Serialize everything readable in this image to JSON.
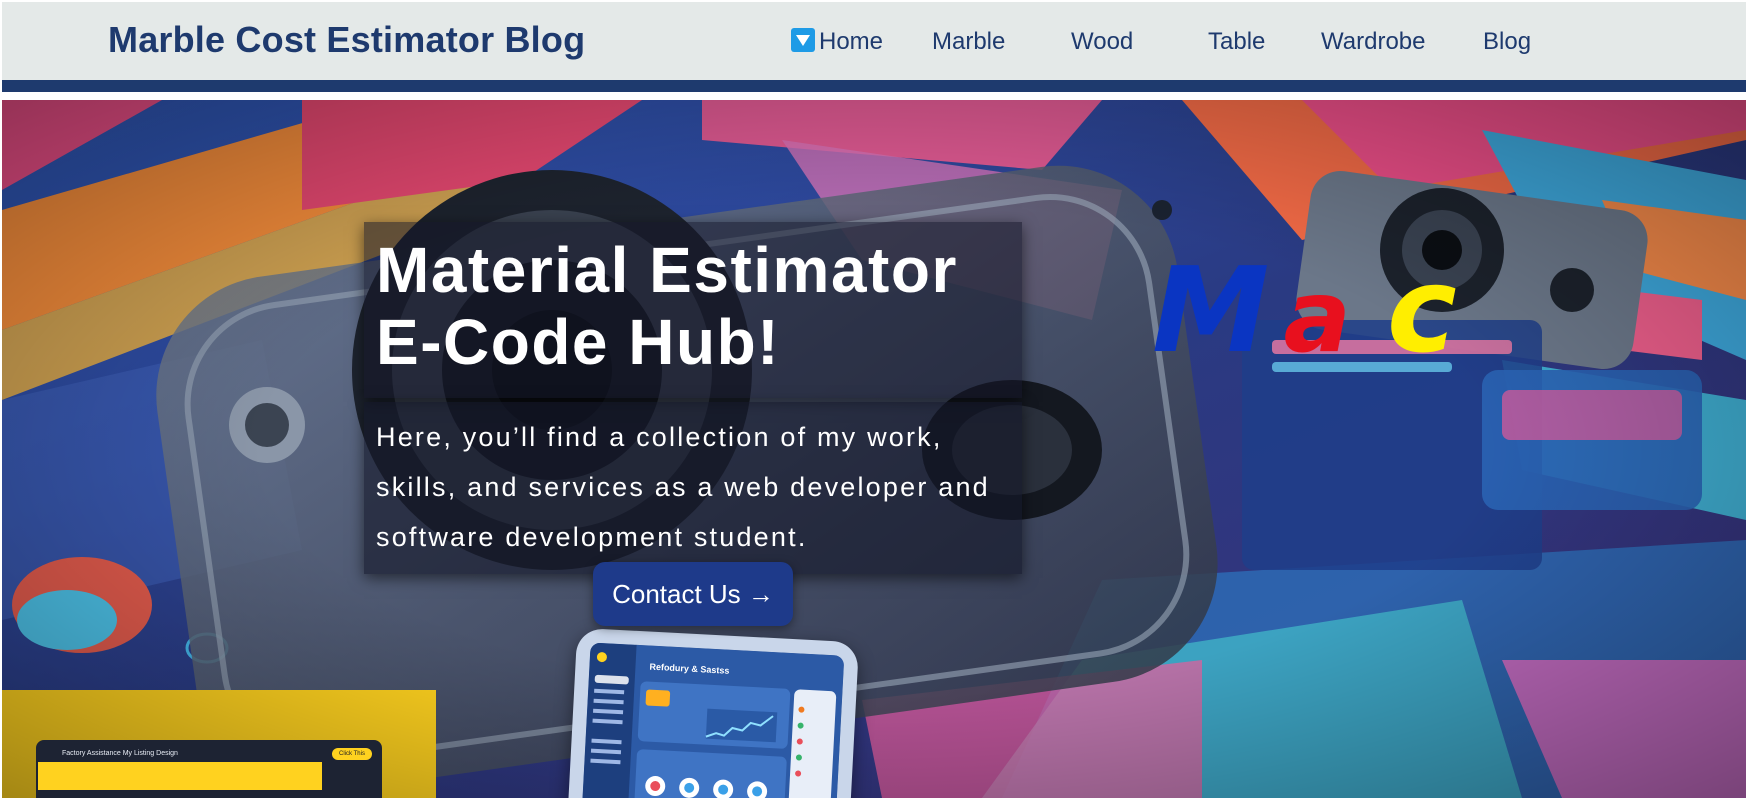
{
  "header": {
    "site_title": "Marble Cost Estimator Blog",
    "nav": [
      {
        "label": "Home",
        "icon": "home-icon",
        "active": true
      },
      {
        "label": "Marble"
      },
      {
        "label": "Wood"
      },
      {
        "label": "Table"
      },
      {
        "label": "Wardrobe"
      },
      {
        "label": "Blog"
      }
    ]
  },
  "hero": {
    "title_line1": "Material Estimator",
    "title_line2": "E-Code Hub!",
    "description": "Here, you’ll find a collection of my work, skills, and services as a web developer and software development student.",
    "cta_label": "Contact Us →",
    "logo": {
      "letters": [
        "M",
        "a",
        "c"
      ],
      "colors": [
        "#0a35c2",
        "#e8101e",
        "#ffee00"
      ]
    },
    "tablet_title": "Refodury & Sastss",
    "laptop_nav": "Factory   Assistance   My Listing   Design",
    "laptop_button": "Click This"
  },
  "colors": {
    "brand_navy": "#1e3a6e",
    "header_bg": "#e4e9e8",
    "cta_bg": "#1e3a8a"
  }
}
